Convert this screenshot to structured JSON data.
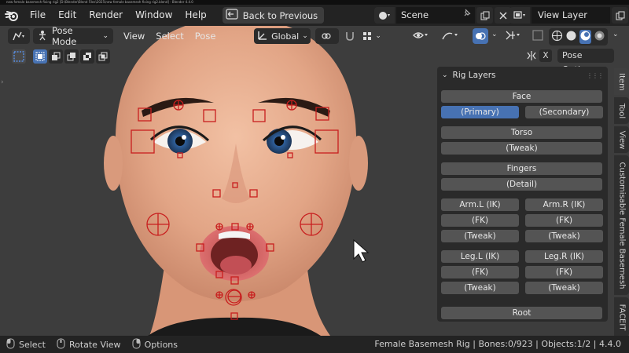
{
  "window_title": "new female basemesh fixing rig2 [D:\\Blender\\Blend Files\\2025\\new female basemesh fixing rig2.blend] - Blender 4.4.0",
  "menu": [
    "File",
    "Edit",
    "Render",
    "Window",
    "Help"
  ],
  "back_button": "Back to Previous",
  "scene": "Scene",
  "view_layer": "View Layer",
  "viewport_header": {
    "mode": "Pose Mode",
    "menus": [
      "View",
      "Select",
      "Pose"
    ],
    "orientation": "Global"
  },
  "pose_options": "Pose Options",
  "x_label": "X",
  "rig_layers": {
    "title": "Rig Layers",
    "face": "Face",
    "primary": "(Primary)",
    "secondary": "(Secondary)",
    "torso": "Torso",
    "tweak": "(Tweak)",
    "fingers": "Fingers",
    "detail": "(Detail)",
    "arm_l_ik": "Arm.L (IK)",
    "arm_r_ik": "Arm.R (IK)",
    "fk": "(FK)",
    "leg_l_ik": "Leg.L (IK)",
    "leg_r_ik": "Leg.R (IK)",
    "root": "Root"
  },
  "side_tabs": [
    "Item",
    "Tool",
    "View",
    "Customisable Female Basemesh",
    "FACEIT"
  ],
  "status": {
    "select": "Select",
    "rotate_view": "Rotate View",
    "options": "Options",
    "info": "Female Basemesh Rig | Bones:0/923 | Objects:1/2 | 4.4.0"
  },
  "colors": {
    "accent": "#4772b3",
    "bone_widget": "#c81e1e",
    "background": "#3d3d3d"
  }
}
